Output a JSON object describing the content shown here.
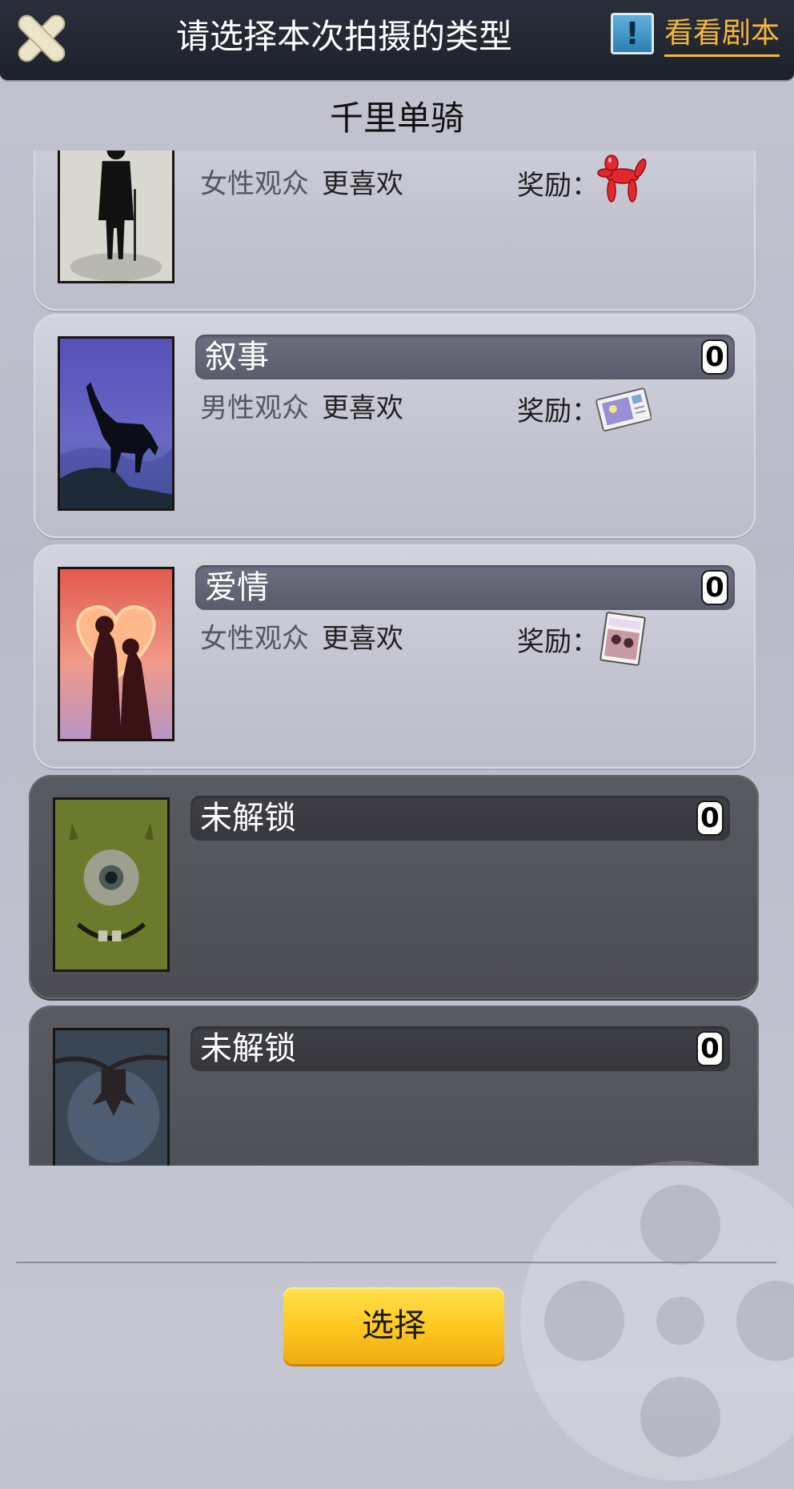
{
  "header": {
    "close_icon": "close-x-icon",
    "title": "请选择本次拍摄的类型",
    "script_icon": "exclamation-icon",
    "script_link": "看看剧本"
  },
  "subtitle": "千里单骑",
  "cards": [
    {
      "name": "",
      "count": "",
      "audience": "女性观众",
      "preference": "更喜欢",
      "reward_label": "奖励：",
      "reward_icon": "balloon-dog-icon",
      "poster": "gentleman-silhouette-poster",
      "locked": false
    },
    {
      "name": "叙事",
      "count": "0",
      "audience": "男性观众",
      "preference": "更喜欢",
      "reward_label": "奖励：",
      "reward_icon": "postcard-icon",
      "poster": "howling-wolf-poster",
      "locked": false
    },
    {
      "name": "爱情",
      "count": "0",
      "audience": "女性观众",
      "preference": "更喜欢",
      "reward_label": "奖励：",
      "reward_icon": "love-magazine-icon",
      "poster": "couple-heart-poster",
      "locked": false
    },
    {
      "name": "未解锁",
      "count": "0",
      "poster": "one-eyed-monster-poster",
      "locked": true
    },
    {
      "name": "未解锁",
      "count": "0",
      "poster": "bat-moon-poster",
      "locked": true
    }
  ],
  "footer": {
    "select_label": "选择"
  },
  "colors": {
    "accent": "#f7b63a",
    "button": "#fcc61f",
    "header_bg": "#1d212b"
  }
}
